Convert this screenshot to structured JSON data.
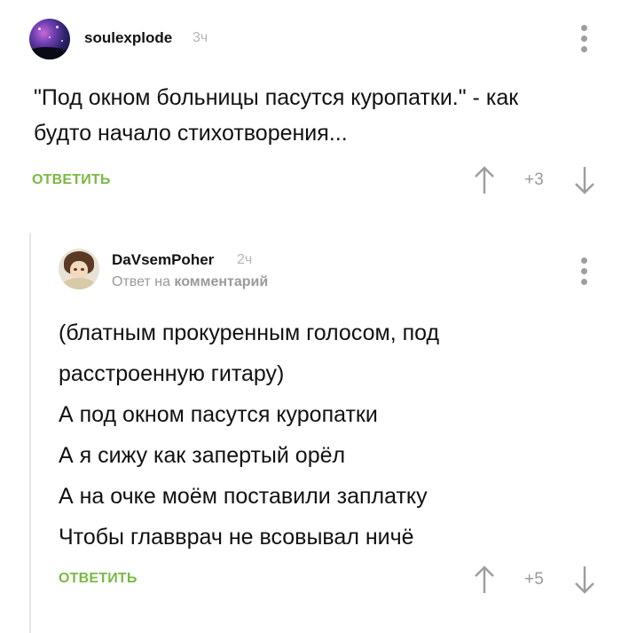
{
  "comments": [
    {
      "username": "soulexplode",
      "time": "3ч",
      "text_lines": [
        "\"Под окном больницы пасутся куропатки.\" - как",
        "будто начало стихотворения..."
      ],
      "reply_label": "ОТВЕТИТЬ",
      "score": "+3",
      "avatar_icon": "space-avatar"
    },
    {
      "username": "DaVsemPoher",
      "time": "2ч",
      "reply_prefix": "Ответ на",
      "reply_target": "комментарий",
      "text_lines": [
        "(блатным прокуренным голосом, под",
        "расстроенную гитару)",
        "А под окном пасутся куропатки",
        "А я сижу как запертый орёл",
        "А на очке моём поставили заплатку",
        "Чтобы главврач не всовывал ничё"
      ],
      "reply_label": "ОТВЕТИТЬ",
      "score": "+5",
      "avatar_icon": "anime-character-avatar"
    }
  ],
  "colors": {
    "reply_green": "#7bb845",
    "muted": "#9a9a9a",
    "thread_line": "#e6e6e6"
  }
}
